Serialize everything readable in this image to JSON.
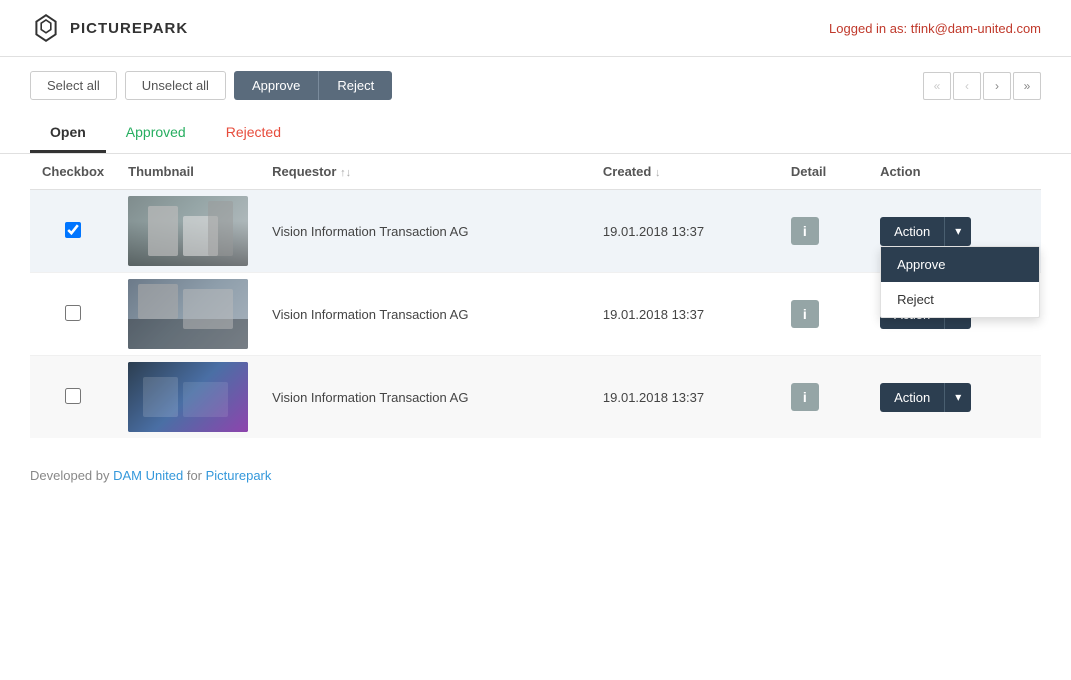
{
  "header": {
    "logo_text": "PICTUREPARK",
    "logged_in_label": "Logged in as:",
    "logged_in_email": "tfink@dam-united.com"
  },
  "toolbar": {
    "select_all_label": "Select all",
    "unselect_all_label": "Unselect all",
    "approve_label": "Approve",
    "reject_label": "Reject"
  },
  "pagination": {
    "prev_double": "«",
    "prev_single": "‹",
    "next_single": "›",
    "next_double": "»"
  },
  "tabs": [
    {
      "id": "open",
      "label": "Open",
      "active": true,
      "style": "active"
    },
    {
      "id": "approved",
      "label": "Approved",
      "active": false,
      "style": "green"
    },
    {
      "id": "rejected",
      "label": "Rejected",
      "active": false,
      "style": "red"
    }
  ],
  "table": {
    "columns": [
      {
        "id": "checkbox",
        "label": "Checkbox",
        "sortable": false
      },
      {
        "id": "thumbnail",
        "label": "Thumbnail",
        "sortable": false
      },
      {
        "id": "requestor",
        "label": "Requestor",
        "sortable": true
      },
      {
        "id": "created",
        "label": "Created",
        "sortable": true
      },
      {
        "id": "detail",
        "label": "Detail",
        "sortable": false
      },
      {
        "id": "action",
        "label": "Action",
        "sortable": false
      }
    ],
    "rows": [
      {
        "id": 1,
        "checked": true,
        "requestor": "Vision Information Transaction AG",
        "created": "19.01.2018 13:37",
        "thumb_class": "thumb-1",
        "has_dropdown": true,
        "action_label": "Action"
      },
      {
        "id": 2,
        "checked": false,
        "requestor": "Vision Information Transaction AG",
        "created": "19.01.2018 13:37",
        "thumb_class": "thumb-2",
        "has_dropdown": false,
        "action_label": "Action"
      },
      {
        "id": 3,
        "checked": false,
        "requestor": "Vision Information Transaction AG",
        "created": "19.01.2018 13:37",
        "thumb_class": "thumb-3",
        "has_dropdown": false,
        "action_label": "Action"
      }
    ],
    "dropdown": {
      "approve_label": "Approve",
      "reject_label": "Reject"
    }
  },
  "footer": {
    "developed_by": "Developed by",
    "dam_united": "DAM United",
    "for": "for",
    "picturepark": "Picturepark"
  }
}
